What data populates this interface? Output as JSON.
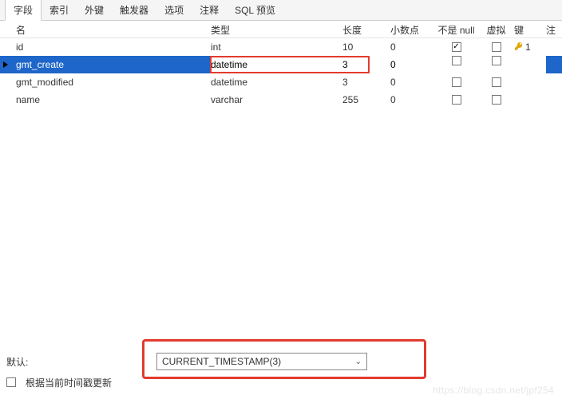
{
  "tabs": {
    "items": [
      "字段",
      "索引",
      "外键",
      "触发器",
      "选项",
      "注释",
      "SQL 预览"
    ],
    "active_index": 0
  },
  "columns_header": {
    "name": "名",
    "type": "类型",
    "length": "长度",
    "decimals": "小数点",
    "notnull": "不是 null",
    "virtual": "虚拟",
    "key": "键",
    "extra": "注"
  },
  "rows": [
    {
      "name": "id",
      "type": "int",
      "length": "10",
      "decimals": "0",
      "notnull": true,
      "virtual": false,
      "key": "1",
      "selected": false
    },
    {
      "name": "gmt_create",
      "type": "datetime",
      "length": "3",
      "decimals": "0",
      "notnull": false,
      "virtual": false,
      "key": "",
      "selected": true
    },
    {
      "name": "gmt_modified",
      "type": "datetime",
      "length": "3",
      "decimals": "0",
      "notnull": false,
      "virtual": false,
      "key": "",
      "selected": false
    },
    {
      "name": "name",
      "type": "varchar",
      "length": "255",
      "decimals": "0",
      "notnull": false,
      "virtual": false,
      "key": "",
      "selected": false
    }
  ],
  "bottom": {
    "default_label": "默认:",
    "default_value": "CURRENT_TIMESTAMP(3)",
    "on_update_label": "根据当前时间戳更新",
    "on_update_checked": false
  },
  "watermark": "https://blog.csdn.net/jpf254"
}
